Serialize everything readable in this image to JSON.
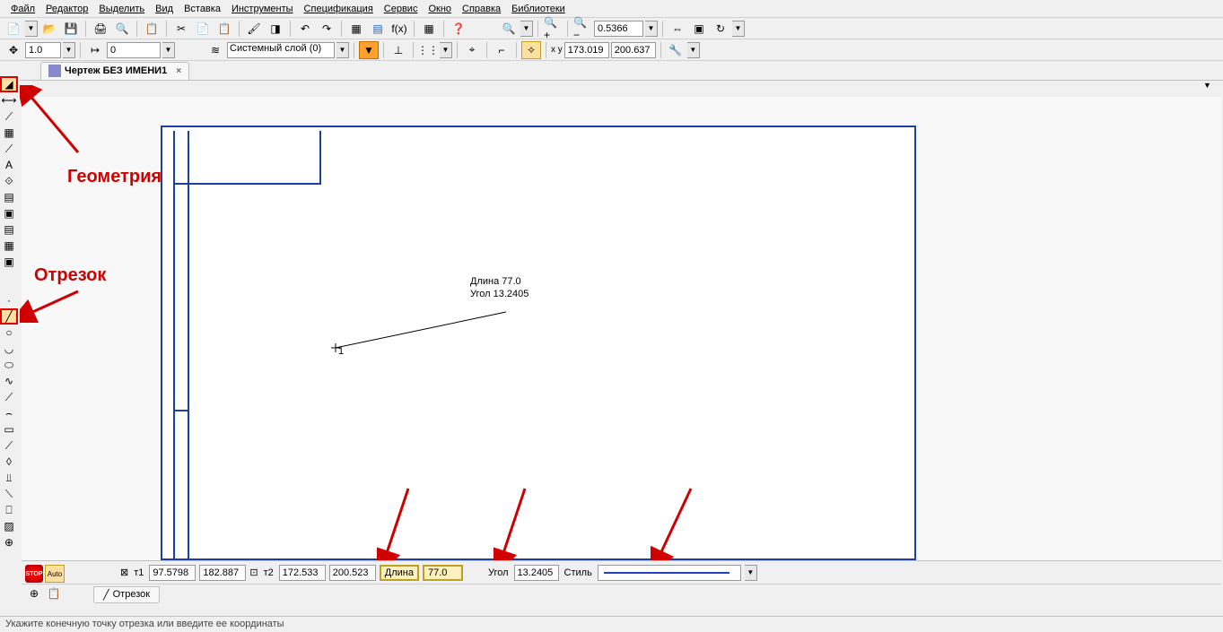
{
  "menu": {
    "items": [
      {
        "label": "Файл",
        "u": 0
      },
      {
        "label": "Редактор",
        "u": 0
      },
      {
        "label": "Выделить",
        "u": 0
      },
      {
        "label": "Вид",
        "u": 0
      },
      {
        "label": "Вставка",
        "u": 4
      },
      {
        "label": "Инструменты",
        "u": 0
      },
      {
        "label": "Спецификация",
        "u": 0
      },
      {
        "label": "Сервис",
        "u": 0
      },
      {
        "label": "Окно",
        "u": 0
      },
      {
        "label": "Справка",
        "u": 0
      },
      {
        "label": "Библиотеки",
        "u": 0
      }
    ]
  },
  "toolbar1": {
    "zoom_value": "0.5366"
  },
  "toolbar2": {
    "line_weight": "1.0",
    "step": "0",
    "layer_label": "Системный слой (0)",
    "coord_x": "173.019",
    "coord_y": "200.637"
  },
  "tab": {
    "title": "Чертеж БЕЗ ИМЕНИ1"
  },
  "canvas": {
    "length_label": "Длина 77.0",
    "angle_label": "Угол  13.2405",
    "point_label": "1"
  },
  "annotations": {
    "geometry": "Геометрия",
    "segment": "Отрезок"
  },
  "params": {
    "t1_label": "т1",
    "t1_x": "97.5798",
    "t1_y": "182.887",
    "t2_label": "т2",
    "t2_x": "172.533",
    "t2_y": "200.523",
    "length_label": "Длина",
    "length_value": "77.0",
    "angle_label": "Угол",
    "angle_value": "13.2405",
    "style_label": "Стиль"
  },
  "bottom_tab": {
    "label": "Отрезок"
  },
  "status": {
    "text": "Укажите конечную точку отрезка или введите ее координаты"
  }
}
